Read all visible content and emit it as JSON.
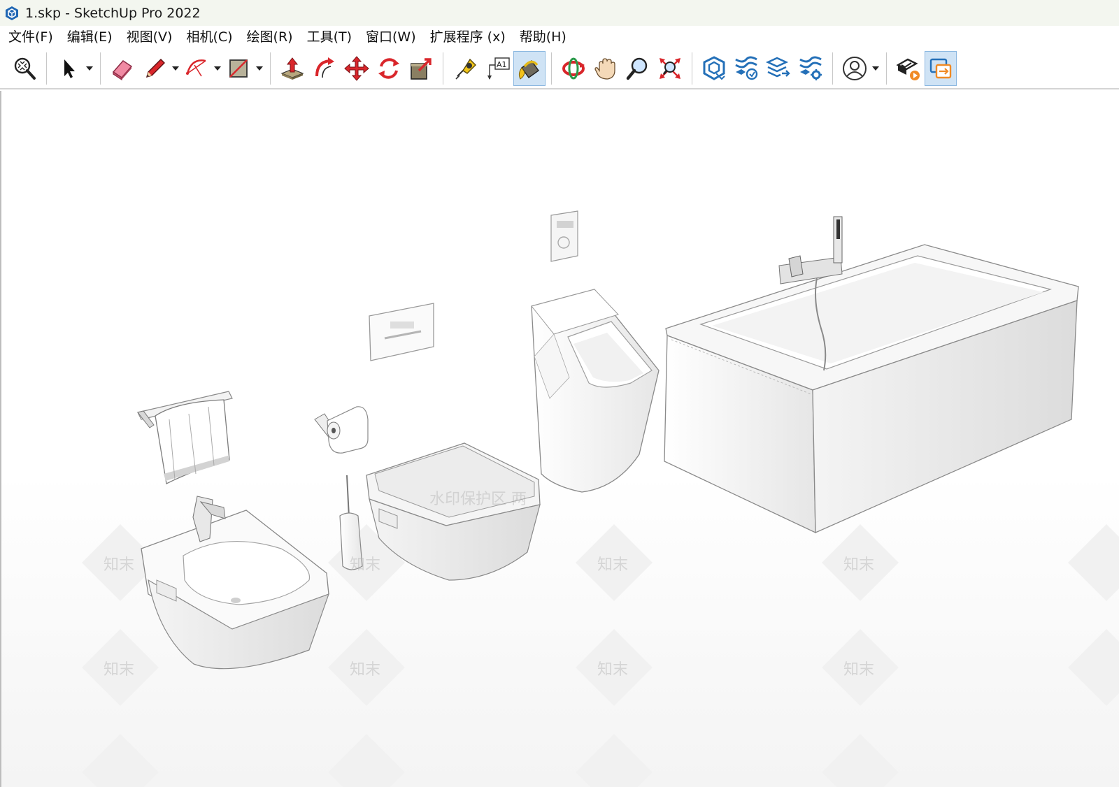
{
  "window": {
    "title": "1.skp - SketchUp Pro 2022",
    "app_icon": "sketchup-logo-icon"
  },
  "menu": {
    "items": [
      {
        "label": "文件(F)"
      },
      {
        "label": "编辑(E)"
      },
      {
        "label": "视图(V)"
      },
      {
        "label": "相机(C)"
      },
      {
        "label": "绘图(R)"
      },
      {
        "label": "工具(T)"
      },
      {
        "label": "窗口(W)"
      },
      {
        "label": "扩展程序 (x)"
      },
      {
        "label": "帮助(H)"
      }
    ]
  },
  "toolbar": {
    "tools": [
      "zoom-extents-icon",
      "select-icon",
      "eraser-icon",
      "pencil-icon",
      "arc-icon",
      "rectangle-icon",
      "push-pull-icon",
      "follow-me-icon",
      "move-icon",
      "rotate-icon",
      "scale-icon",
      "tape-measure-icon",
      "text-label-icon",
      "paint-bucket-icon",
      "orbit-icon",
      "pan-icon",
      "zoom-icon",
      "zoom-window-icon",
      "3d-warehouse-icon",
      "extension-warehouse-icon",
      "layout-send-icon",
      "extension-manager-icon",
      "account-icon",
      "trimble-connect-icon",
      "share-model-icon"
    ],
    "active_tool": "paint-bucket-icon",
    "colors": {
      "red": "#d9262b",
      "accent": "#2470b8",
      "active_bg": "#cfe3f5"
    }
  },
  "viewport": {
    "watermark_text": "水印保护区 两",
    "watermark_tile_text": "知末",
    "models": [
      "towel-rail",
      "toilet-paper-holder",
      "flush-plate",
      "urinal-flush-plate",
      "bidet",
      "toilet-brush",
      "wall-hung-toilet",
      "urinal",
      "bathtub",
      "shower-mixer"
    ]
  }
}
